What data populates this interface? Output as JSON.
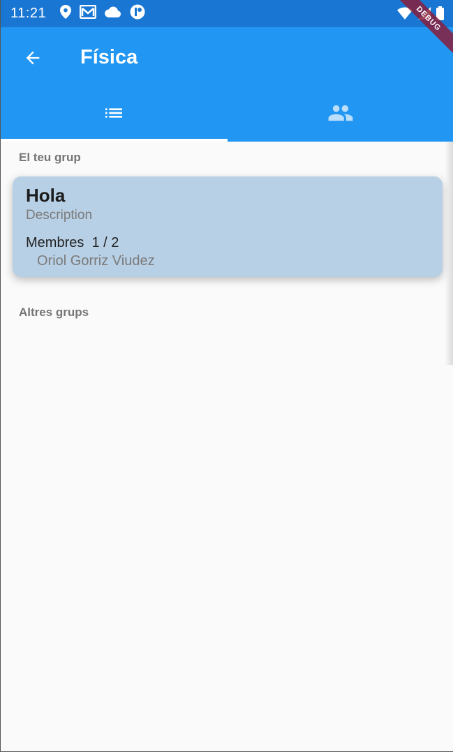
{
  "status_bar": {
    "time": "11:21",
    "left_icons": [
      "location-icon",
      "gmail-icon",
      "cloud-icon",
      "app-notification-icon"
    ],
    "right_icons": [
      "wifi-icon",
      "signal-icon",
      "battery-icon"
    ]
  },
  "debug_banner": {
    "label": "DEBUG"
  },
  "app_bar": {
    "title": "Física",
    "back_icon": "arrow-back-icon"
  },
  "tabs": [
    {
      "icon": "list-icon",
      "selected": true
    },
    {
      "icon": "group-icon",
      "selected": false
    }
  ],
  "sections": {
    "your_group": "El teu grup",
    "other_groups": "Altres grups"
  },
  "group_card": {
    "title": "Hola",
    "description": "Description",
    "members_label": "Membres  1 / 2",
    "members": [
      "Oriol Gorriz Viudez"
    ]
  },
  "colors": {
    "status_bar": "#1976d2",
    "app_bar": "#2196f3",
    "card": "#b8d0e5",
    "background": "#fafafa"
  }
}
